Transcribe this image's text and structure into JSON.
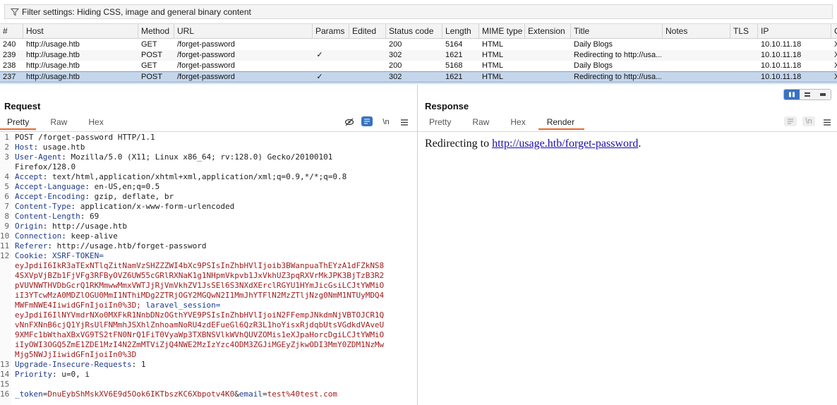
{
  "filter": {
    "label": "Filter settings: Hiding CSS, image and general binary content"
  },
  "table": {
    "columns": [
      "#",
      "Host",
      "Method",
      "URL",
      "Params",
      "Edited",
      "Status code",
      "Length",
      "MIME type",
      "Extension",
      "Title",
      "Notes",
      "TLS",
      "IP",
      "C"
    ],
    "rows": [
      {
        "id": "240",
        "host": "http://usage.htb",
        "method": "GET",
        "url": "/forget-password",
        "params": "",
        "status": "200",
        "length": "5164",
        "mime": "HTML",
        "title": "Daily Blogs",
        "ip": "10.10.11.18",
        "extra": "X"
      },
      {
        "id": "239",
        "host": "http://usage.htb",
        "method": "POST",
        "url": "/forget-password",
        "params": "✓",
        "status": "302",
        "length": "1621",
        "mime": "HTML",
        "title": "Redirecting to http://usa...",
        "ip": "10.10.11.18",
        "extra": "X"
      },
      {
        "id": "238",
        "host": "http://usage.htb",
        "method": "GET",
        "url": "/forget-password",
        "params": "",
        "status": "200",
        "length": "5168",
        "mime": "HTML",
        "title": "Daily Blogs",
        "ip": "10.10.11.18",
        "extra": "X"
      },
      {
        "id": "237",
        "host": "http://usage.htb",
        "method": "POST",
        "url": "/forget-password",
        "params": "✓",
        "status": "302",
        "length": "1621",
        "mime": "HTML",
        "title": "Redirecting to http://usa...",
        "ip": "10.10.11.18",
        "extra": "X"
      }
    ]
  },
  "request": {
    "title": "Request",
    "tabs": [
      "Pretty",
      "Raw",
      "Hex"
    ],
    "active_tab": "Pretty",
    "newline_tool": "\\n",
    "lines": [
      {
        "n": "1",
        "text": "POST /forget-password HTTP/1.1"
      },
      {
        "n": "2",
        "key": "Host",
        "val": "usage.htb"
      },
      {
        "n": "3",
        "key": "User-Agent",
        "val": "Mozilla/5.0 (X11; Linux x86_64; rv:128.0) Gecko/20100101"
      },
      {
        "n": "",
        "text": "Firefox/128.0"
      },
      {
        "n": "4",
        "key": "Accept",
        "val": "text/html,application/xhtml+xml,application/xml;q=0.9,*/*;q=0.8"
      },
      {
        "n": "5",
        "key": "Accept-Language",
        "val": "en-US,en;q=0.5"
      },
      {
        "n": "6",
        "key": "Accept-Encoding",
        "val": "gzip, deflate, br"
      },
      {
        "n": "7",
        "key": "Content-Type",
        "val": "application/x-www-form-urlencoded"
      },
      {
        "n": "8",
        "key": "Content-Length",
        "val": "69"
      },
      {
        "n": "9",
        "key": "Origin",
        "val": "http://usage.htb"
      },
      {
        "n": "10",
        "key": "Connection",
        "val": "keep-alive"
      },
      {
        "n": "11",
        "key": "Referer",
        "val": "http://usage.htb/forget-password"
      },
      {
        "n": "12",
        "key": "Cookie",
        "cookie_name": "XSRF-TOKEN="
      },
      {
        "n": "",
        "cv": "eyJpdiI6IkR3aTExNTlqZitNamVzSHZZZWI4bXc9PSIsInZhbHVlIjoib3BWanpuaThEYzA1dFZkNS8"
      },
      {
        "n": "",
        "cv": "4SXVpVjBZb1FjVFg3RFByOVZ6UW55cGRlRXNaK1g1NHpmVkpvb1JxVkhUZ3pqRXVrMkJPK3BjTzB3R2"
      },
      {
        "n": "",
        "cv": "pVUVNWTHVDbGcrQ1RKMmwwMmxVWTJjRjVmVkhZV1JsSEl6S3NXdXErclRGYU1HYmJicGsiLCJtYWMiO"
      },
      {
        "n": "",
        "cv": "iI3YTcwMzA0MDZlOGU0MmI1NThiMDg2ZTRjOGY2MGQwN2I1MmJhYTFlN2MzZTljNzg0NmM1NTUyMDQ4"
      },
      {
        "n": "",
        "cv": "MWFmNWE4IiwidGFnIjoiIn0%3D;",
        "cookie_name2": "laravel_session="
      },
      {
        "n": "",
        "cv": "eyJpdiI6IlNYVmdrNXo0MXFkR1NnbDNzOGthYVE9PSIsInZhbHVlIjoiN2FFempJNkdmNjVBTOJCR1Q"
      },
      {
        "n": "",
        "cv": "vNnFXNnB6cjQ1YjRsUlFNMmhJSXhlZnhoamNoRU4zdEFueGl6QzR3L1hoYisxRjdqbUtsVGdkdVAveU"
      },
      {
        "n": "",
        "cv": "9XMFc1bWthaXBxVG9TS2tFN0NrQ1FiT0VyaWp3TXBNSVlkWVhQUVZOMis1eXJpaHorcDgiLCJtYWMiO"
      },
      {
        "n": "",
        "cv": "iIyOWI3OGQ5ZmE1ZDE1MzI4N2ZmMTViZjQ4NWE2MzIzYzc4ODM3ZGJiMGEyZjkwODI3MmY0ZDM1NzMw"
      },
      {
        "n": "",
        "cv": "Mjg5NWJjIiwidGFnIjoiIn0%3D"
      },
      {
        "n": "13",
        "key": "Upgrade-Insecure-Requests",
        "val": "1"
      },
      {
        "n": "14",
        "key": "Priority",
        "val": "u=0, i"
      },
      {
        "n": "15",
        "text": ""
      },
      {
        "n": "16",
        "body": true,
        "b1": "_token",
        "b2": "DnuEybShMskXV6E9d5Ook6IKTbszKC6Xbpotv4K0",
        "b3": "email",
        "b4": "test%40test.com"
      }
    ]
  },
  "response": {
    "title": "Response",
    "tabs": [
      "Pretty",
      "Raw",
      "Hex",
      "Render"
    ],
    "active_tab": "Render",
    "newline_tool": "\\n",
    "render_prefix": "Redirecting to ",
    "render_link": "http://usage.htb/forget-password",
    "render_suffix": "."
  }
}
